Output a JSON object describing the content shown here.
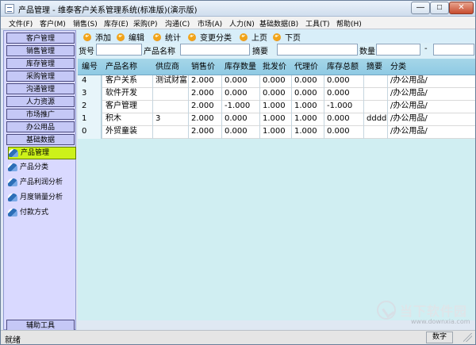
{
  "window": {
    "title": "产品管理 - 维泰客户关系管理系统(标准版)(演示版)",
    "controls": {
      "minimize": "—",
      "maximize": "□",
      "close": "✕"
    }
  },
  "menu": [
    "文件(F)",
    "客户(M)",
    "销售(S)",
    "库存(E)",
    "采购(P)",
    "沟通(C)",
    "市场(A)",
    "人力(N)",
    "基础数据(B)",
    "工具(T)",
    "帮助(H)"
  ],
  "sidebar": {
    "modules": [
      "客户管理",
      "销售管理",
      "库存管理",
      "采购管理",
      "沟通管理",
      "人力资源",
      "市场推广",
      "办公用品",
      "基础数据"
    ],
    "sub_items": [
      {
        "label": "产品管理",
        "active": true
      },
      {
        "label": "产品分类",
        "active": false
      },
      {
        "label": "产品利润分析",
        "active": false
      },
      {
        "label": "月度销量分析",
        "active": false
      },
      {
        "label": "付款方式",
        "active": false
      }
    ],
    "bottom_tool": "辅助工具"
  },
  "toolbar": {
    "items": [
      "添加",
      "编辑",
      "统计",
      "变更分类",
      "上页",
      "下页"
    ]
  },
  "filter": {
    "goods_no_label": "货号",
    "goods_no_value": "",
    "product_name_label": "产品名称",
    "product_name_value": "",
    "summary_label": "摘要",
    "summary_value": "",
    "quantity_label": "数量",
    "quantity_from": "",
    "range_separator": "-",
    "quantity_to": ""
  },
  "table": {
    "headers": [
      "编号",
      "产品名称",
      "供应商",
      "销售价",
      "库存数量",
      "批发价",
      "代理价",
      "库存总额",
      "摘要",
      "分类"
    ],
    "rows": [
      [
        "4",
        "客户关系",
        "测试财富",
        "2.000",
        "0.000",
        "0.000",
        "0.000",
        "0.000",
        "",
        "/办公用品/"
      ],
      [
        "3",
        "软件开发",
        "",
        "2.000",
        "0.000",
        "0.000",
        "0.000",
        "0.000",
        "",
        "/办公用品/"
      ],
      [
        "2",
        "客户管理",
        "",
        "2.000",
        "-1.000",
        "1.000",
        "1.000",
        "-1.000",
        "",
        "/办公用品/"
      ],
      [
        "1",
        "积木",
        "3",
        "2.000",
        "0.000",
        "1.000",
        "1.000",
        "0.000",
        "dddd",
        "/办公用品/"
      ],
      [
        "0",
        "外贸童装",
        "",
        "2.000",
        "0.000",
        "1.000",
        "1.000",
        "0.000",
        "",
        "/办公用品/"
      ]
    ]
  },
  "status": {
    "left": "就绪",
    "right": "数字"
  },
  "watermark": {
    "text": "当下软件园",
    "url": "www.downxia.com"
  },
  "colors": {
    "sidebar_background": "#d9d9ff",
    "grid_background": "#d0eef2",
    "selected_item": "#cdf11a",
    "table_header": "#9ad0e7"
  }
}
